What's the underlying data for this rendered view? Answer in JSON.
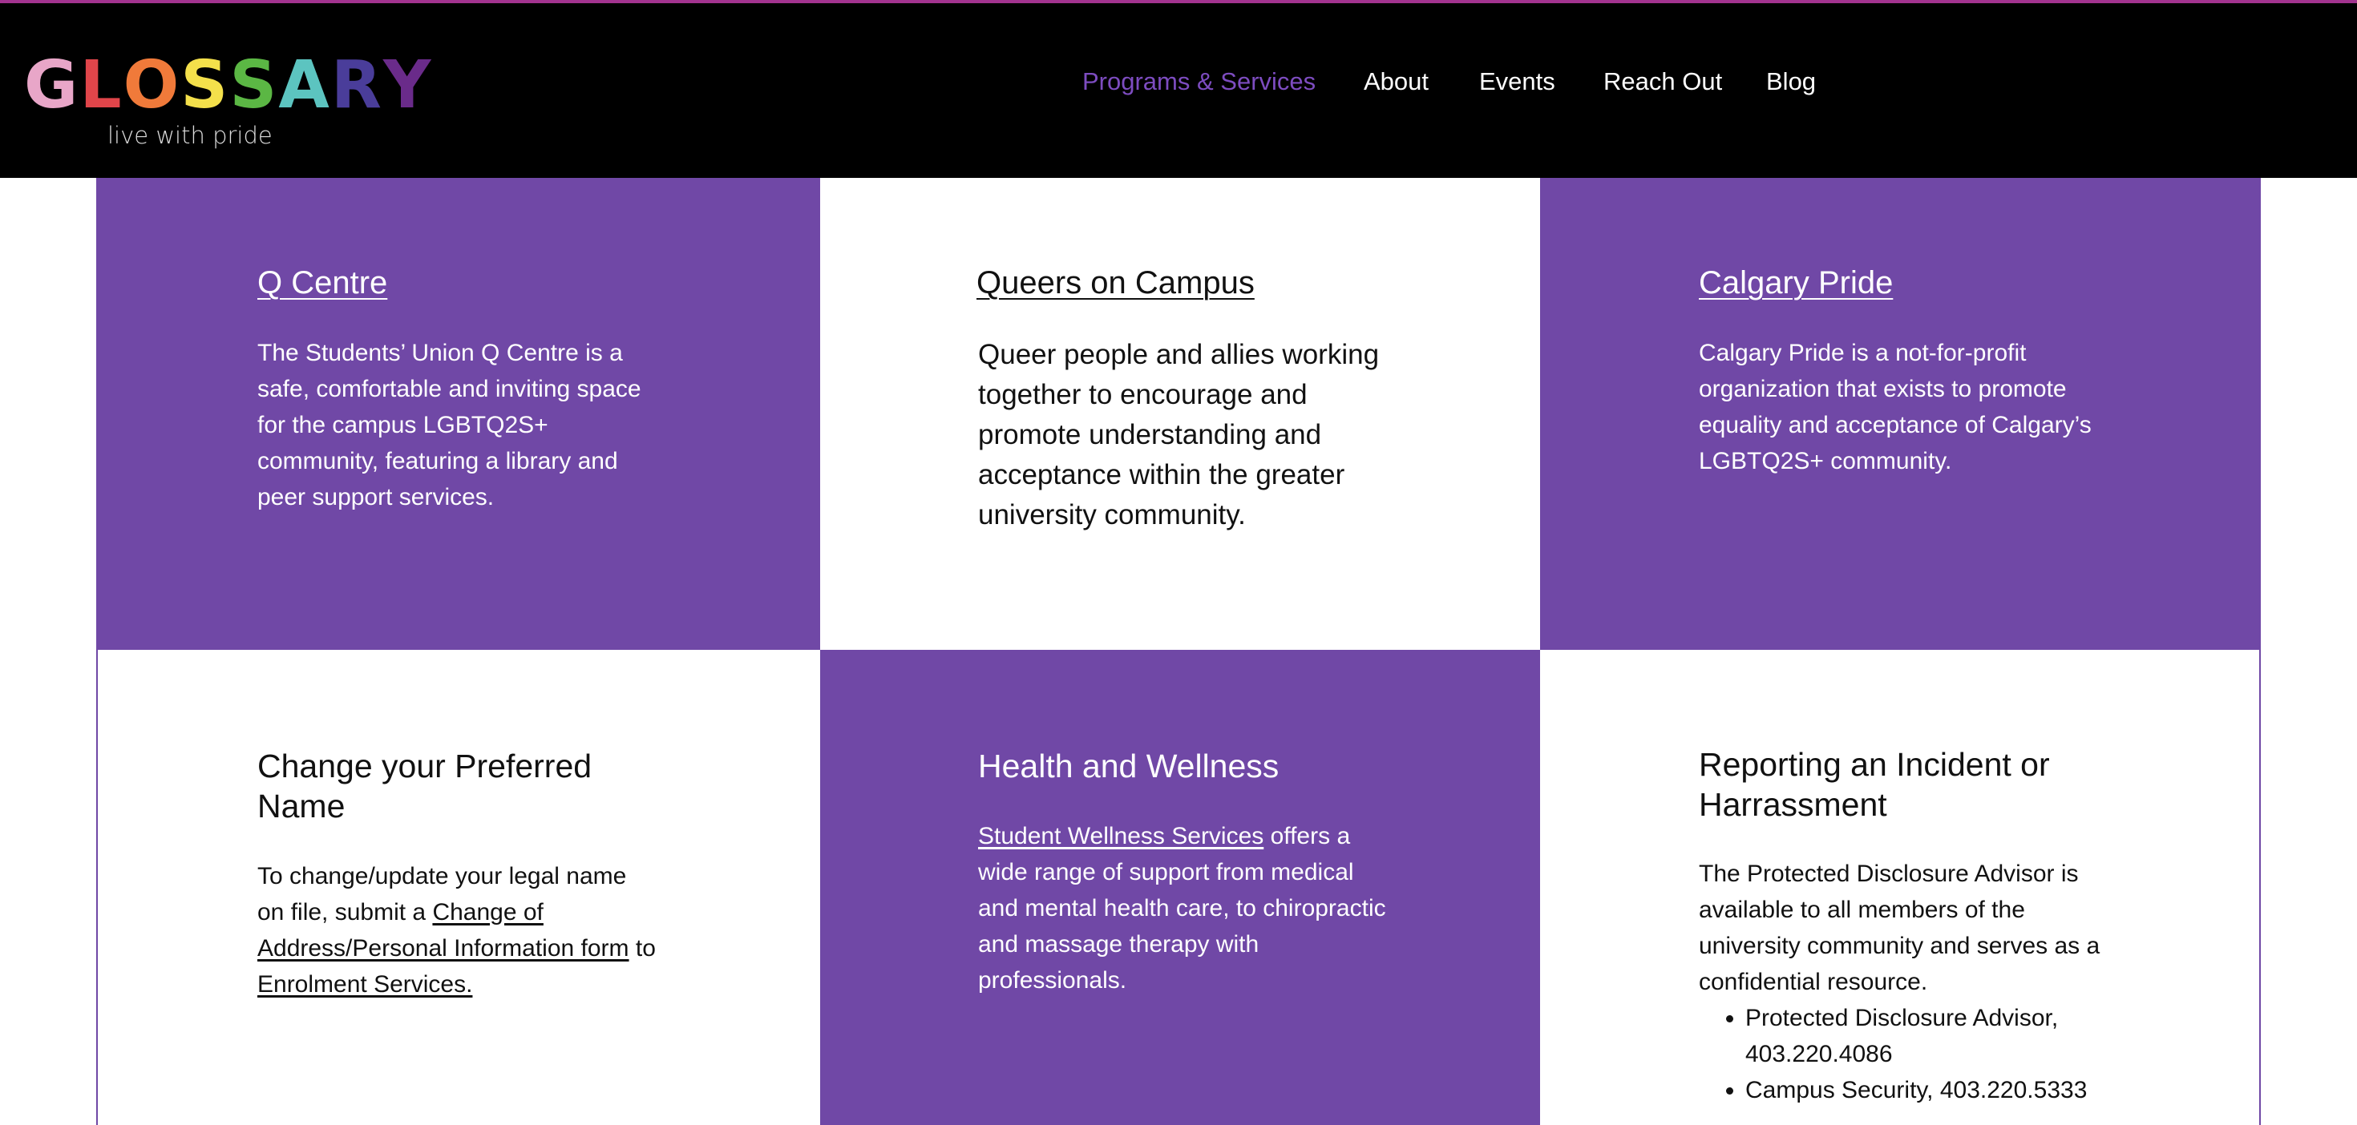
{
  "header": {
    "logo_letters": [
      {
        "char": "G",
        "color": "#e8a6c8"
      },
      {
        "char": "L",
        "color": "#e0454a"
      },
      {
        "char": "O",
        "color": "#f07a3a"
      },
      {
        "char": "S",
        "color": "#f4e04b"
      },
      {
        "char": "S",
        "color": "#5bb744"
      },
      {
        "char": "A",
        "color": "#5cc4c0"
      },
      {
        "char": "R",
        "color": "#4a3d9a"
      },
      {
        "char": "Y",
        "color": "#6a2b8a"
      }
    ],
    "tagline": "live with pride"
  },
  "nav": {
    "items": [
      {
        "label": "Programs & Services",
        "active": true
      },
      {
        "label": "About",
        "active": false
      },
      {
        "label": "Events",
        "active": false
      },
      {
        "label": "Reach Out",
        "active": false
      },
      {
        "label": "Blog",
        "active": false
      }
    ]
  },
  "cards": {
    "q_centre": {
      "title": "Q Centre",
      "body": "The Students’ Union Q Centre is a safe, comfortable and inviting space for the campus LGBTQ2S+ community, featuring a library and peer support services."
    },
    "queers_on_campus": {
      "title": "Queers on Campus",
      "body": "Queer people and allies working together to encourage and promote understanding and acceptance within the greater university community."
    },
    "calgary_pride": {
      "title": "Calgary Pride",
      "body": "Calgary Pride is a not-for-profit organization that exists to promote equality and acceptance of Calgary’s LGBTQ2S+ community."
    },
    "preferred_name": {
      "title": "Change your Preferred Name",
      "body_prefix": "To change/update your legal name on file, submit a ",
      "form_link": "Change of Address/Personal Information form",
      "body_middle": " to ",
      "enrolment_link": "Enrolment Services."
    },
    "health": {
      "title": "Health and Wellness",
      "wellness_link": "Student Wellness Services",
      "body_suffix": " offers a wide range of support from medical and mental health care, to chiropractic and massage therapy with professionals."
    },
    "reporting": {
      "title": "Reporting an Incident or Harrassment",
      "body": "The Protected Disclosure Advisor is available to all members of the university community and serves as a confidential resource.",
      "contacts": [
        "Protected Disclosure Advisor, 403.220.4086",
        "Campus Security, 403.220.5333"
      ]
    }
  },
  "colors": {
    "accent_purple": "#7048a6",
    "nav_active": "#7d4cc0",
    "header_bg": "#000000",
    "top_line": "#a2338f"
  }
}
